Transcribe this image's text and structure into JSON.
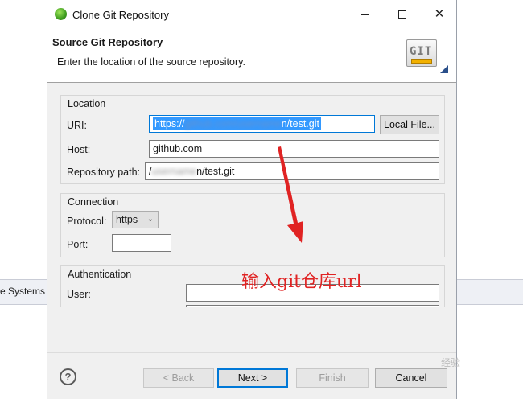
{
  "background_app": {
    "left_strip_text": "e Systems"
  },
  "window": {
    "title": "Clone Git Repository",
    "controls": {
      "minimize": "—",
      "maximize": "☐",
      "close": "✕"
    }
  },
  "header": {
    "title": "Source Git Repository",
    "description": "Enter the location of the source repository.",
    "logo_text": "GIT"
  },
  "location": {
    "group_label": "Location",
    "uri_label": "URI:",
    "uri_value_prefix": "https://",
    "uri_value_obscured": "github.com/username",
    "uri_value_suffix": "n/test.git",
    "local_file_button": "Local File...",
    "host_label": "Host:",
    "host_value": "github.com",
    "repo_path_label": "Repository path:",
    "repo_path_prefix": "/",
    "repo_path_obscured": "username",
    "repo_path_suffix": "n/test.git"
  },
  "connection": {
    "group_label": "Connection",
    "protocol_label": "Protocol:",
    "protocol_value": "https",
    "port_label": "Port:",
    "port_value": ""
  },
  "authentication": {
    "group_label": "Authentication",
    "user_label": "User:",
    "user_value": "",
    "password_value": ""
  },
  "footer": {
    "help_icon": "?",
    "back_button": "< Back",
    "next_button": "Next >",
    "finish_button": "Finish",
    "cancel_button": "Cancel"
  },
  "annotation": {
    "text": "输入git仓库url",
    "color": "#e02323"
  },
  "watermark": {
    "text": "经验"
  }
}
